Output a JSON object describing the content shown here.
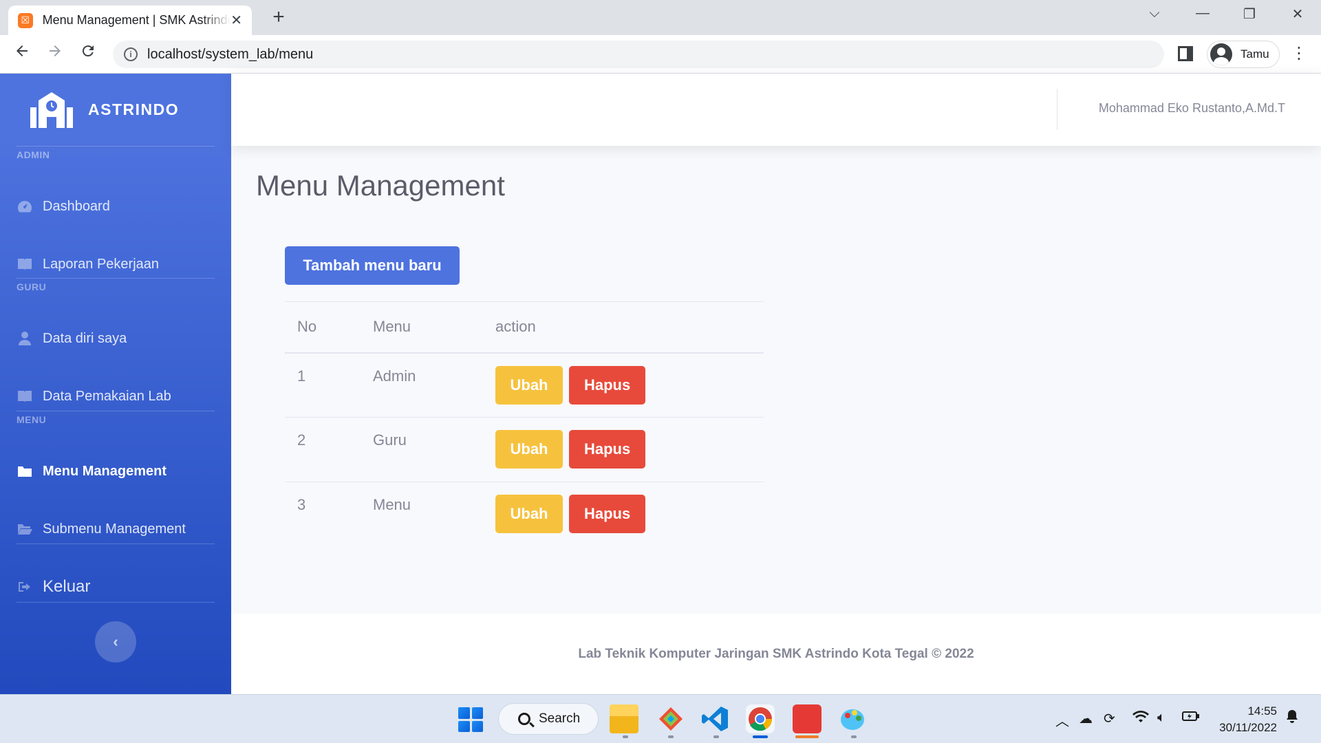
{
  "browser": {
    "tab_title": "Menu Management | SMK Astrindo",
    "tab_close": "✕",
    "new_tab": "+",
    "url": "localhost/system_lab/menu",
    "profile_name": "Tamu",
    "controls": {
      "tab_search": "⌵",
      "minimize": "—",
      "restore": "❐",
      "close": "✕"
    }
  },
  "sidebar": {
    "brand": "ASTRINDO",
    "sections": [
      {
        "heading": "ADMIN",
        "items": [
          {
            "label": "Dashboard",
            "icon": "tachometer-icon"
          },
          {
            "label": "Laporan Pekerjaan",
            "icon": "book-icon"
          }
        ]
      },
      {
        "heading": "GURU",
        "items": [
          {
            "label": "Data diri saya",
            "icon": "user-icon"
          },
          {
            "label": "Data Pemakaian Lab",
            "icon": "book-icon"
          }
        ]
      },
      {
        "heading": "MENU",
        "items": [
          {
            "label": "Menu Management",
            "icon": "folder-icon",
            "active": true
          },
          {
            "label": "Submenu Management",
            "icon": "folder-open-icon"
          }
        ]
      }
    ],
    "logout": "Keluar",
    "toggle": "‹"
  },
  "topbar": {
    "user_name": "Mohammad Eko Rustanto,A.Md.T"
  },
  "main": {
    "title": "Menu Management",
    "add_button": "Tambah menu baru",
    "table": {
      "headers": [
        "No",
        "Menu",
        "action"
      ],
      "rows": [
        {
          "no": "1",
          "menu": "Admin"
        },
        {
          "no": "2",
          "menu": "Guru"
        },
        {
          "no": "3",
          "menu": "Menu"
        }
      ],
      "edit_label": "Ubah",
      "delete_label": "Hapus"
    }
  },
  "footer": {
    "text": "Lab Teknik Komputer Jaringan SMK Astrindo Kota Tegal © 2022"
  },
  "taskbar": {
    "search_label": "Search",
    "time": "14:55",
    "date": "30/11/2022"
  },
  "colors": {
    "primary": "#4e73df",
    "sidebar_gradient_end": "#224abe",
    "warning": "#f6c23e",
    "danger": "#e74a3b",
    "text_muted": "#858796"
  }
}
